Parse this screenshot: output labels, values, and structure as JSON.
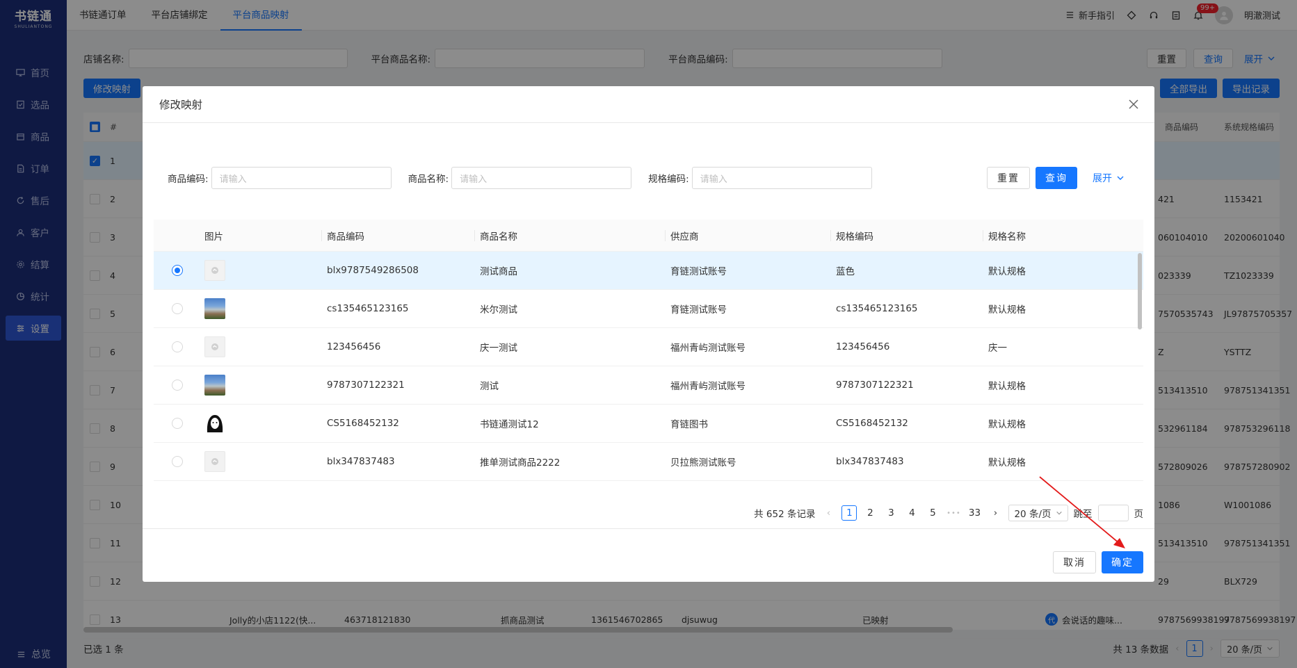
{
  "sidebar": {
    "logo_main": "书链通",
    "logo_sub": "SHULIANTONG",
    "items": [
      {
        "label": "首页",
        "icon": "monitor-icon"
      },
      {
        "label": "选品",
        "icon": "checklist-icon"
      },
      {
        "label": "商品",
        "icon": "box-icon"
      },
      {
        "label": "订单",
        "icon": "document-icon"
      },
      {
        "label": "售后",
        "icon": "refresh-icon"
      },
      {
        "label": "客户",
        "icon": "user-icon"
      },
      {
        "label": "结算",
        "icon": "gear-icon"
      },
      {
        "label": "统计",
        "icon": "chart-icon"
      },
      {
        "label": "设置",
        "icon": "sliders-icon",
        "active": true
      }
    ],
    "bottom_label": "总览"
  },
  "topbar": {
    "tabs": [
      {
        "label": "书链通订单"
      },
      {
        "label": "平台店铺绑定"
      },
      {
        "label": "平台商品映射",
        "active": true
      }
    ],
    "guide_label": "新手指引",
    "notification_badge": "99+",
    "username": "明澈测试"
  },
  "page": {
    "filters": {
      "shop_label": "店铺名称:",
      "product_name_label": "平台商品名称:",
      "product_code_label": "平台商品编码:"
    },
    "reset_label": "重置",
    "query_label": "查询",
    "expand_label": "展开",
    "modify_mapping_label": "修改映射",
    "export_all_label": "全部导出",
    "export_record_label": "导出记录",
    "col_index": "#",
    "col_product_code": "商品编码",
    "col_sys_spec": "系统规格编码",
    "rows": [
      {
        "idx": "1",
        "code": "",
        "spec": ""
      },
      {
        "idx": "2",
        "code": "421",
        "spec": "1153421"
      },
      {
        "idx": "3",
        "code": "060104010",
        "spec": "20200601040"
      },
      {
        "idx": "4",
        "code": "023339",
        "spec": "TZ1023339"
      },
      {
        "idx": "5",
        "code": "7570535743",
        "spec": "JL97875705357"
      },
      {
        "idx": "6",
        "code": "Z",
        "spec": "YSTTZ"
      },
      {
        "idx": "7",
        "code": "513413510",
        "spec": "978751341351"
      },
      {
        "idx": "8",
        "code": "532961184",
        "spec": "978753296118"
      },
      {
        "idx": "9",
        "code": "572809026",
        "spec": "978757280902"
      },
      {
        "idx": "10",
        "code": "1086",
        "spec": "W1001086"
      },
      {
        "idx": "11",
        "code": "513413510",
        "spec": "978751341351"
      },
      {
        "idx": "12",
        "code": "29",
        "spec": "BLX729"
      },
      {
        "idx": "13",
        "code": "9787569938197",
        "spec": "9787569938197"
      }
    ],
    "row13": {
      "shop": "Jolly的小店1122(快...",
      "platform_code": "463718121830",
      "product": "抓商品测试",
      "sku": "1361546702865",
      "supplier": "djsuwug",
      "status": "已映射",
      "agent_badge": "代",
      "agent_name": "会说话的趣味..."
    },
    "selected_text": "已选 1 条",
    "total_text": "共 13 条数据",
    "current_page": "1",
    "page_size": "20 条/页"
  },
  "modal": {
    "title": "修改映射",
    "search": {
      "code_label": "商品编码:",
      "code_placeholder": "请输入",
      "name_label": "商品名称:",
      "name_placeholder": "请输入",
      "spec_label": "规格编码:",
      "spec_placeholder": "请输入",
      "reset": "重置",
      "query": "查询",
      "expand": "展开"
    },
    "columns": [
      "图片",
      "商品编码",
      "商品名称",
      "供应商",
      "规格编码",
      "规格名称"
    ],
    "rows": [
      {
        "img": "placeholder",
        "code": "blx9787549286508",
        "name": "测试商品",
        "supplier": "育链测试账号",
        "spec_code": "蓝色",
        "spec_name": "默认规格",
        "selected": true
      },
      {
        "img": "road",
        "code": "cs135465123165",
        "name": "米尔测试",
        "supplier": "育链测试账号",
        "spec_code": "cs135465123165",
        "spec_name": "默认规格"
      },
      {
        "img": "placeholder",
        "code": "123456456",
        "name": "庆一测试",
        "supplier": "福州青屿测试账号",
        "spec_code": "123456456",
        "spec_name": "庆一"
      },
      {
        "img": "road",
        "code": "9787307122321",
        "name": "测试",
        "supplier": "福州青屿测试账号",
        "spec_code": "9787307122321",
        "spec_name": "默认规格"
      },
      {
        "img": "face",
        "code": "CS5168452132",
        "name": "书链通测试12",
        "supplier": "育链图书",
        "spec_code": "CS5168452132",
        "spec_name": "默认规格"
      },
      {
        "img": "placeholder",
        "code": "blx347837483",
        "name": "推单测试商品2222",
        "supplier": "贝拉熊测试账号",
        "spec_code": "blx347837483",
        "spec_name": "默认规格"
      }
    ],
    "pagination": {
      "total": "共 652 条记录",
      "pages": [
        "1",
        "2",
        "3",
        "4",
        "5"
      ],
      "ellipsis": "•••",
      "last": "33",
      "page_size": "20 条/页",
      "jump_label": "跳至",
      "page_suffix": "页"
    },
    "cancel": "取消",
    "confirm": "确定"
  },
  "colors": {
    "sidebar_bg": "#1c2f7a",
    "primary": "#1677ff",
    "annotation_arrow": "#e31b1b"
  }
}
